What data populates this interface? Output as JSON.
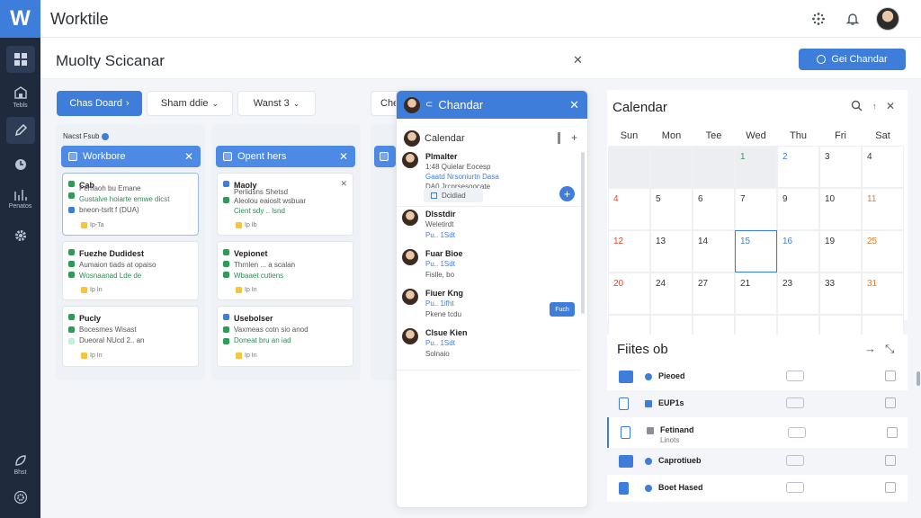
{
  "app": {
    "logo": "W",
    "title": "Worktile"
  },
  "sidebar": {
    "items": [
      {
        "label": "",
        "icon": "grid-icon"
      },
      {
        "label": "Tebls",
        "icon": "building-icon"
      },
      {
        "label": "",
        "icon": "pen-icon"
      },
      {
        "label": "",
        "icon": "clock-icon"
      },
      {
        "label": "Penatos",
        "icon": "chart-icon"
      },
      {
        "label": "",
        "icon": "gear-icon"
      },
      {
        "label": "Bhst",
        "icon": "leaf-icon"
      },
      {
        "label": "",
        "icon": "settings-circle-icon"
      }
    ]
  },
  "header": {
    "page_title": "Muolty Scicanar",
    "calendar_button": "Gei  Chandar"
  },
  "toolbar": {
    "board_button": "Chas Doard",
    "share_button": "Sham ddie",
    "view_button": "Wanst 3"
  },
  "board": {
    "caption": "Nacst  Fsub",
    "columns": [
      {
        "title": "Workbore",
        "cards": [
          {
            "title": "Cab",
            "lines": [
              "Pemaoh bu Emane",
              "Gustalve hoiarte emwe dicst",
              "bneon-tsrlt f (DUA)"
            ],
            "tag": "Ip-Ta"
          },
          {
            "title": "Fuezhe Dudidest",
            "lines": [
              "Aumaion tiads at opaiso",
              "Wosnaanad Lde de"
            ],
            "tag": "Ip In"
          },
          {
            "title": "Pucly",
            "lines": [
              "Bocesmes Wisast",
              "Dueoral NUcd 2.. an"
            ],
            "tag": "Ip In"
          }
        ]
      },
      {
        "title": "Opent hers",
        "cards": [
          {
            "title": "Maoly",
            "lines": [
              "Perlidsns Shetsd",
              "Aleolou eaioslt wsbuar",
              "Cient sdy .. lsnd"
            ],
            "tag": "Ip Ib"
          },
          {
            "title": "Vepionet",
            "lines": [
              "Thrnlen ... a scalan",
              "Wbaaet cutiens"
            ],
            "tag": "Ip In"
          },
          {
            "title": "Usebolser",
            "lines": [
              "Vaxmeas cotn sio anod",
              "Doneat bru an iad"
            ],
            "tag": "Ip In"
          }
        ]
      }
    ]
  },
  "chat": {
    "title": "Chandar",
    "subheader": "Calendar",
    "first": {
      "name": "Plmalter",
      "lines": [
        "1:48  Quielar Eocesp",
        "Gaatd Nrsoniurtn Dasa",
        "DA0 Jrcnrsesoocate"
      ],
      "attachment": "Dcidiad"
    },
    "messages": [
      {
        "name": "Dlsstdir",
        "lines": [
          "Weletirdt",
          "Pu..  1Sdt"
        ]
      },
      {
        "name": "Fuar Bioe",
        "lines": [
          "Pu..  1Sdt",
          "Fislle, bo"
        ]
      },
      {
        "name": "Fiuer Kng",
        "lines": [
          "Pu..  1ifht",
          "Pkene tcdu"
        ]
      },
      {
        "name": "Clsue Kien",
        "lines": [
          "Pu..  1Sdt",
          "Solnaio"
        ]
      }
    ],
    "reply_button": "Fuch"
  },
  "calendar": {
    "title": "Calendar",
    "days": [
      "Sun",
      "Mon",
      "Tee",
      "Wed",
      "Thu",
      "Fri",
      "Sat"
    ],
    "weeks": [
      [
        {
          "d": "",
          "s": "dim"
        },
        {
          "d": "",
          "s": "dim"
        },
        {
          "d": "",
          "s": "dim"
        },
        {
          "d": "1",
          "s": "green dim"
        },
        {
          "d": "2",
          "s": "blue"
        },
        {
          "d": "3",
          "s": ""
        },
        {
          "d": "4",
          "s": ""
        }
      ],
      [
        {
          "d": "4",
          "s": "red"
        },
        {
          "d": "5",
          "s": ""
        },
        {
          "d": "6",
          "s": ""
        },
        {
          "d": "7",
          "s": ""
        },
        {
          "d": "9",
          "s": ""
        },
        {
          "d": "10",
          "s": ""
        },
        {
          "d": "11",
          "s": "orange"
        }
      ],
      [
        {
          "d": "12",
          "s": "red"
        },
        {
          "d": "13",
          "s": ""
        },
        {
          "d": "14",
          "s": ""
        },
        {
          "d": "15",
          "s": "blue today"
        },
        {
          "d": "16",
          "s": "blue"
        },
        {
          "d": "19",
          "s": ""
        },
        {
          "d": "25",
          "s": "orange"
        }
      ],
      [
        {
          "d": "20",
          "s": "red"
        },
        {
          "d": "24",
          "s": ""
        },
        {
          "d": "27",
          "s": ""
        },
        {
          "d": "21",
          "s": ""
        },
        {
          "d": "23",
          "s": ""
        },
        {
          "d": "33",
          "s": ""
        },
        {
          "d": "31",
          "s": "orange"
        }
      ],
      [
        {
          "d": "",
          "s": ""
        },
        {
          "d": "",
          "s": ""
        },
        {
          "d": "",
          "s": ""
        },
        {
          "d": "",
          "s": ""
        },
        {
          "d": "",
          "s": ""
        },
        {
          "d": "",
          "s": ""
        },
        {
          "d": "",
          "s": ""
        }
      ]
    ]
  },
  "files": {
    "title": "Fiites ob",
    "rows": [
      {
        "name": "Pieoed",
        "sub": "",
        "icon": "folder-icon"
      },
      {
        "name": "EUP1s",
        "sub": "",
        "icon": "document-icon"
      },
      {
        "name": "Fetinand",
        "sub": "Linots",
        "icon": "document-icon"
      },
      {
        "name": "Caprotiueb",
        "sub": "",
        "icon": "folder-icon"
      },
      {
        "name": "Boet Hased",
        "sub": "",
        "icon": "document-icon"
      }
    ]
  },
  "colors": {
    "accent": "#3f7ddb",
    "sidebar": "#1f2a3d",
    "today_border": "#3f7ddb"
  }
}
